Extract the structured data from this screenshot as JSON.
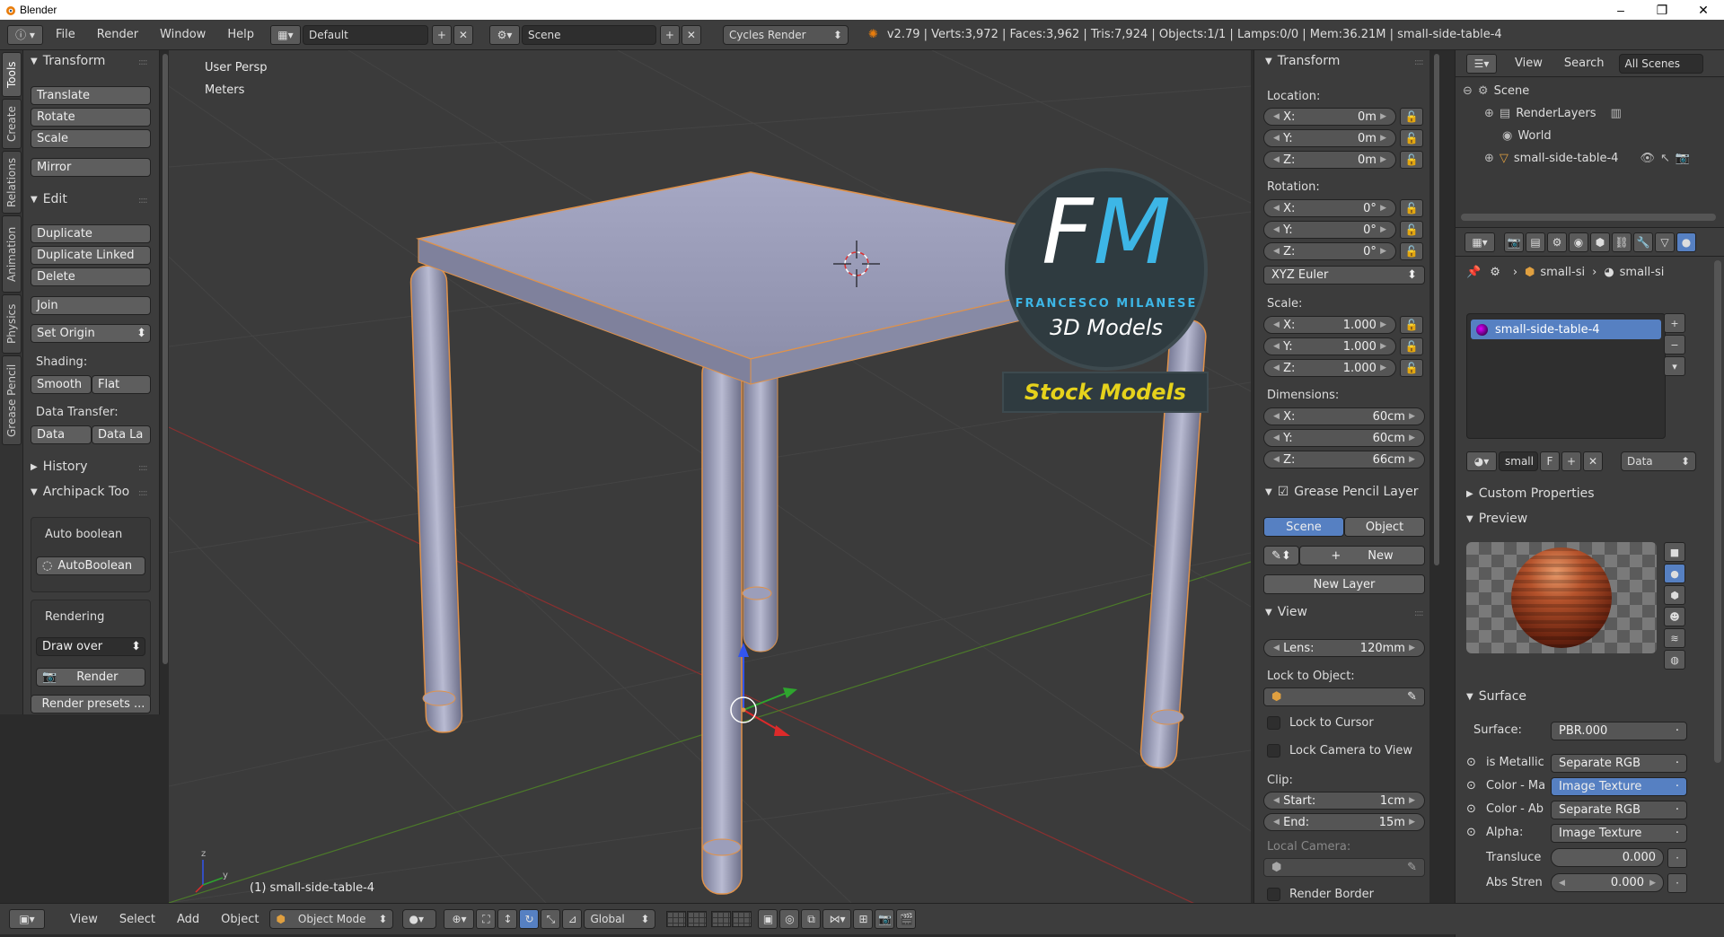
{
  "window": {
    "title": "Blender"
  },
  "header": {
    "menus": [
      "File",
      "Render",
      "Window",
      "Help"
    ],
    "layout": "Default",
    "scene": "Scene",
    "engine": "Cycles Render",
    "stats": "v2.79 | Verts:3,972 | Faces:3,962 | Tris:7,924 | Objects:1/1 | Lamps:0/0 | Mem:36.21M | small-side-table-4"
  },
  "tool_tabs": [
    "Tools",
    "Create",
    "Relations",
    "Animation",
    "Physics",
    "Grease Pencil"
  ],
  "tools": {
    "transform_title": "Transform",
    "translate": "Translate",
    "rotate": "Rotate",
    "scale": "Scale",
    "mirror": "Mirror",
    "edit_title": "Edit",
    "duplicate": "Duplicate",
    "duplicate_linked": "Duplicate Linked",
    "delete": "Delete",
    "join": "Join",
    "set_origin": "Set Origin",
    "shading_label": "Shading:",
    "smooth": "Smooth",
    "flat": "Flat",
    "data_transfer_label": "Data Transfer:",
    "data": "Data",
    "data_la": "Data La",
    "history_title": "History",
    "archipack_title": "Archipack Too",
    "auto_boolean_label": "Auto boolean",
    "autoboolean_btn": "AutoBoolean",
    "rendering_label": "Rendering",
    "draw_over": "Draw over",
    "render_btn": "Render",
    "render_presets": "Render presets ..."
  },
  "viewport": {
    "view_name": "User Persp",
    "units": "Meters",
    "object_label": "(1) small-side-table-4",
    "logo_f": "F",
    "logo_m": "M",
    "logo_sub1": "FRANCESCO MILANESE",
    "logo_sub2": "3D Models",
    "stock": "Stock Models"
  },
  "npanel": {
    "transform_title": "Transform",
    "location_label": "Location:",
    "loc": [
      {
        "k": "X:",
        "v": "0m"
      },
      {
        "k": "Y:",
        "v": "0m"
      },
      {
        "k": "Z:",
        "v": "0m"
      }
    ],
    "rotation_label": "Rotation:",
    "rot": [
      {
        "k": "X:",
        "v": "0°"
      },
      {
        "k": "Y:",
        "v": "0°"
      },
      {
        "k": "Z:",
        "v": "0°"
      }
    ],
    "rot_mode": "XYZ Euler",
    "scale_label": "Scale:",
    "scl": [
      {
        "k": "X:",
        "v": "1.000"
      },
      {
        "k": "Y:",
        "v": "1.000"
      },
      {
        "k": "Z:",
        "v": "1.000"
      }
    ],
    "dimensions_label": "Dimensions:",
    "dim": [
      {
        "k": "X:",
        "v": "60cm"
      },
      {
        "k": "Y:",
        "v": "60cm"
      },
      {
        "k": "Z:",
        "v": "66cm"
      }
    ],
    "gp_title": "Grease Pencil Layer",
    "gp_scene": "Scene",
    "gp_object": "Object",
    "gp_new": "New",
    "gp_new_layer": "New Layer",
    "view_title": "View",
    "lens_k": "Lens:",
    "lens_v": "120mm",
    "lock_to_object": "Lock to Object:",
    "lock_to_cursor": "Lock to Cursor",
    "lock_camera": "Lock Camera to View",
    "clip_label": "Clip:",
    "clip_start_k": "Start:",
    "clip_start_v": "1cm",
    "clip_end_k": "End:",
    "clip_end_v": "15m",
    "local_camera": "Local Camera:",
    "render_border": "Render Border"
  },
  "outliner": {
    "view": "View",
    "search": "Search",
    "all_scenes": "All Scenes",
    "scene": "Scene",
    "render_layers": "RenderLayers",
    "world": "World",
    "object": "small-side-table-4"
  },
  "properties": {
    "crumb1": "small-si",
    "crumb2": "small-si",
    "material": "small-side-table-4",
    "mat_short": "small",
    "mat_f": "F",
    "data_dd": "Data",
    "custom_props": "Custom Properties",
    "preview": "Preview",
    "surface_title": "Surface",
    "surface_k": "Surface:",
    "surface_v": "PBR.000",
    "inputs": [
      {
        "k": "is Metallic",
        "v": "Separate RGB",
        "blue": false
      },
      {
        "k": "Color - Ma",
        "v": "Image Texture",
        "blue": true
      },
      {
        "k": "Color - Ab",
        "v": "Separate RGB",
        "blue": false
      },
      {
        "k": "Alpha:",
        "v": "Image Texture",
        "blue": false
      }
    ],
    "transluce_k": "Transluce",
    "transluce_v": "0.000",
    "abs_k": "Abs Stren",
    "abs_v": "0.000"
  },
  "bottom": {
    "menus": [
      "View",
      "Select",
      "Add",
      "Object"
    ],
    "mode": "Object Mode",
    "orientation": "Global"
  }
}
